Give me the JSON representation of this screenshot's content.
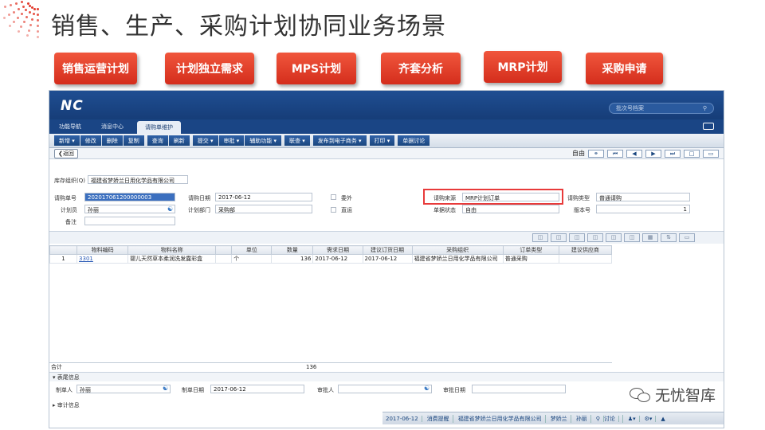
{
  "slide": {
    "title": "销售、生产、采购计划协同业务场景",
    "buttons": [
      "销售运营计划",
      "计划独立需求",
      "MPS计划",
      "齐套分析",
      "MRP计划",
      "采购申请"
    ],
    "brand_color": "#e23a2c"
  },
  "app": {
    "logo": "NC",
    "search_placeholder": "批次号档案",
    "nav": {
      "items": [
        "功能导航",
        "消息中心",
        "请购单维护"
      ],
      "active_index": 2
    },
    "toolbar": [
      "新增",
      "修改",
      "删除",
      "复制",
      "查询",
      "刷新",
      "提交",
      "审批",
      "辅助功能",
      "联查",
      "发布到电子商务",
      "打印",
      "单据讨论"
    ],
    "toolbar_dropdown": [
      "新增",
      "提交",
      "审批",
      "辅助功能",
      "联查",
      "发布到电子商务",
      "打印"
    ],
    "back_label": "返回",
    "mode_label": "自由",
    "header": {
      "org_label": "库存组织(Q)",
      "org_value": "福建省梦娇兰日用化学品有限公司",
      "req_no_label": "请购单号",
      "req_no_value": "202017061200000003",
      "req_date_label": "请购日期",
      "req_date_value": "2017-06-12",
      "outsource_label": "委外",
      "source_label": "请购来源",
      "source_value": "MRP计划订单",
      "type_label": "请购类型",
      "type_value": "普通请购",
      "planner_label": "计划员",
      "planner_value": "孙丽",
      "dept_label": "计划部门",
      "dept_value": "采购部",
      "direct_label": "直运",
      "status_label": "单据状态",
      "status_value": "自由",
      "version_label": "版本号",
      "version_value": "1",
      "remark_label": "备注"
    },
    "grid": {
      "columns": [
        "",
        "物料编码",
        "物料名称",
        "",
        "单位",
        "数量",
        "需求日期",
        "建议订货日期",
        "采购组织",
        "订单类型",
        "建议供应商"
      ],
      "rows": [
        [
          "1",
          "3301",
          "婴儿天然草本柔润洗发露彩盒",
          "",
          "个",
          "136",
          "2017-06-12",
          "2017-06-12",
          "福建省梦娇兰日用化学品有限公司",
          "普通采购",
          ""
        ]
      ],
      "total_label": "合计",
      "total_value": "136"
    },
    "tail": {
      "section_label": "表尾信息",
      "creator_label": "制单人",
      "creator_value": "孙丽",
      "create_date_label": "制单日期",
      "create_date_value": "2017-06-12",
      "approver_label": "审批人",
      "approve_date_label": "审批日期",
      "audit_label": "审计信息"
    },
    "statusbar": [
      "2017-06-12",
      "消费提醒",
      "福建省梦娇兰日用化学品有限公司",
      "梦娇兰",
      "孙丽",
      "讨论"
    ]
  },
  "watermark": "无忧智库"
}
